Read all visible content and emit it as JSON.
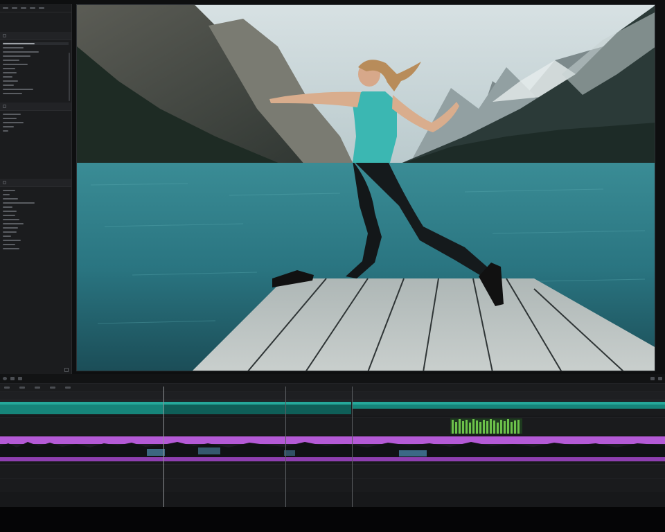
{
  "colors": {
    "video_track": "#25a89a",
    "audio_track_purple": "#b45ad6",
    "audio_green": "#6cc24a",
    "panel_bg": "#1b1c1e"
  },
  "left_panel": {
    "icons": [
      "folder-icon",
      "import-icon",
      "list-view-icon",
      "grid-view-icon",
      "search-icon"
    ]
  },
  "viewer": {
    "content": "person-lunging-on-dock-photo"
  },
  "viewer_controls": {
    "icons": [
      "play-icon",
      "loop-icon",
      "mark-in-icon",
      "mark-out-icon",
      "zoom-icon"
    ]
  },
  "timeline": {
    "icons": [
      "razor-icon",
      "select-icon",
      "snap-icon",
      "link-icon",
      "marker-icon"
    ]
  }
}
